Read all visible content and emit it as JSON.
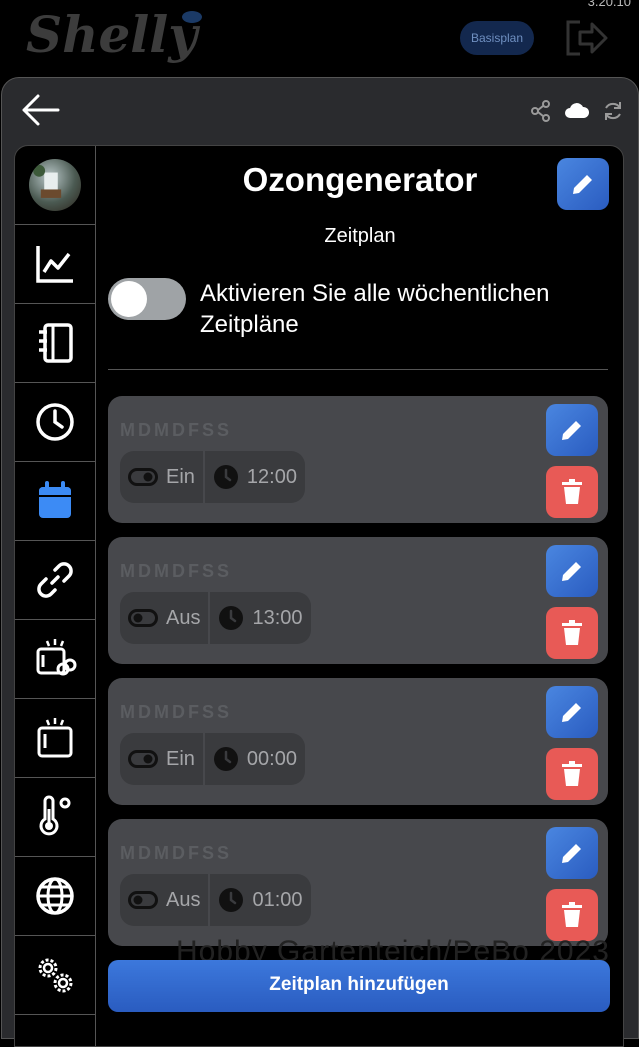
{
  "header": {
    "logo_text": "Shelly",
    "version": "3.20.10",
    "plan_button": "Basisplan"
  },
  "device": {
    "title": "Ozongenerator",
    "subtitle": "Zeitplan"
  },
  "toggle_all": {
    "label": "Aktivieren Sie alle wöchentlichen Zeitpläne",
    "enabled": false
  },
  "schedules": [
    {
      "days": "MDMDFSS",
      "state": "Ein",
      "time": "12:00"
    },
    {
      "days": "MDMDFSS",
      "state": "Aus",
      "time": "13:00"
    },
    {
      "days": "MDMDFSS",
      "state": "Ein",
      "time": "00:00"
    },
    {
      "days": "MDMDFSS",
      "state": "Aus",
      "time": "01:00"
    }
  ],
  "watermark": "Hobby Gartenteich/PeBo 2023",
  "add_button": "Zeitplan hinzufügen",
  "sidebar": [
    "avatar",
    "chart-icon",
    "notebook-icon",
    "clock-icon",
    "calendar-icon",
    "link-icon",
    "scenes-icon",
    "device-icon",
    "thermometer-icon",
    "globe-icon",
    "settings-icon"
  ],
  "colors": {
    "accent": "#3c78dc",
    "danger": "#e85a56",
    "card": "#47484c"
  }
}
